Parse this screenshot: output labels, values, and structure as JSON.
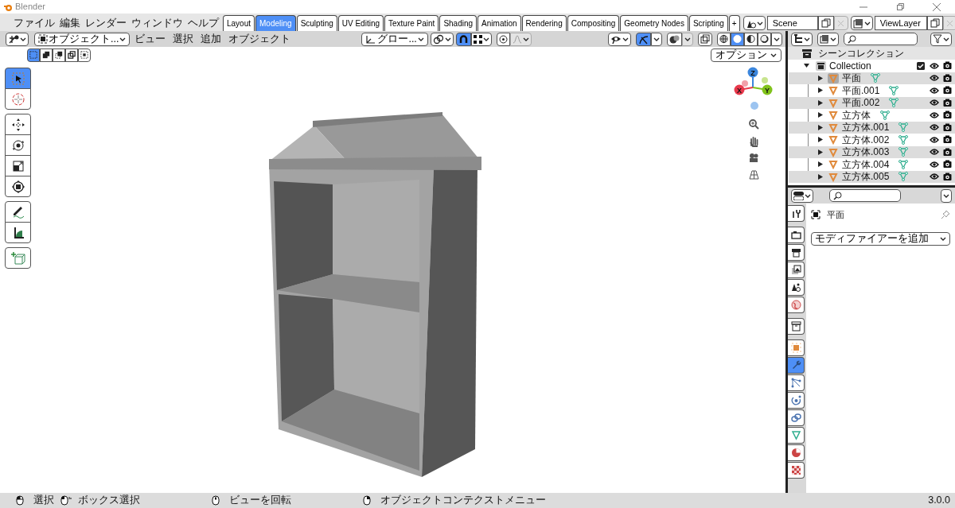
{
  "window": {
    "title": "Blender"
  },
  "menu": [
    "ファイル",
    "編集",
    "レンダー",
    "ウィンドウ",
    "ヘルプ"
  ],
  "workspaces": [
    {
      "label": "Layout",
      "selected": false
    },
    {
      "label": "Modeling",
      "selected": true
    },
    {
      "label": "Sculpting",
      "selected": false
    },
    {
      "label": "UV Editing",
      "selected": false
    },
    {
      "label": "Texture Paint",
      "selected": false
    },
    {
      "label": "Shading",
      "selected": false
    },
    {
      "label": "Animation",
      "selected": false
    },
    {
      "label": "Rendering",
      "selected": false
    },
    {
      "label": "Compositing",
      "selected": false
    },
    {
      "label": "Geometry Nodes",
      "selected": false
    },
    {
      "label": "Scripting",
      "selected": false
    }
  ],
  "add_workspace": "+",
  "scene": {
    "value": "Scene"
  },
  "view_layer": {
    "value": "ViewLayer"
  },
  "viewport": {
    "mode": "オブジェクト...",
    "menus": [
      "ビュー",
      "選択",
      "追加",
      "オブジェクト"
    ],
    "orientation": "グロー...",
    "snap": {
      "on": true
    },
    "proportional": {
      "on": false
    },
    "gizmos": {
      "on": true
    },
    "overlays": {
      "on": false
    },
    "xray": {
      "on": false
    },
    "shading": [
      {
        "kind": "wireframe",
        "selected": false
      },
      {
        "kind": "solid",
        "selected": true
      },
      {
        "kind": "material",
        "selected": false
      },
      {
        "kind": "rendered",
        "selected": false
      }
    ],
    "select_modes": [
      {
        "selected": true
      },
      {
        "selected": false
      },
      {
        "selected": false
      },
      {
        "selected": false
      },
      {
        "selected": false
      }
    ],
    "options": "オプション",
    "tool_groups": [
      {
        "tools": [
          {
            "kind": "select",
            "selected": true
          },
          {
            "kind": "cursor",
            "selected": false
          }
        ]
      },
      {
        "tools": [
          {
            "kind": "move",
            "selected": false
          },
          {
            "kind": "rotate",
            "selected": false
          },
          {
            "kind": "scale",
            "selected": false
          },
          {
            "kind": "transform",
            "selected": false
          }
        ]
      },
      {
        "tools": [
          {
            "kind": "annotate",
            "selected": false
          },
          {
            "kind": "measure",
            "selected": false
          }
        ]
      },
      {
        "tools": [
          {
            "kind": "add_cube",
            "selected": false
          }
        ]
      }
    ],
    "axes": [
      "Z",
      "X",
      "Y"
    ]
  },
  "outliner": {
    "root": "シーンコレクション",
    "collection": {
      "label": "Collection",
      "expanded": true,
      "checked": true,
      "children": [
        {
          "label": "平面",
          "selected": true
        },
        {
          "label": "平面.001",
          "selected": false
        },
        {
          "label": "平面.002",
          "selected": false
        },
        {
          "label": "立方体",
          "selected": false
        },
        {
          "label": "立方体.001",
          "selected": false
        },
        {
          "label": "立方体.002",
          "selected": false
        },
        {
          "label": "立方体.003",
          "selected": false
        },
        {
          "label": "立方体.004",
          "selected": false
        },
        {
          "label": "立方体.005",
          "selected": false
        }
      ]
    }
  },
  "properties": {
    "object": "平面",
    "add_modifier": "モディファイアーを追加",
    "tabs": [
      {
        "kind": "tool",
        "selected": false
      },
      {
        "kind": "render",
        "selected": false
      },
      {
        "kind": "output",
        "selected": false
      },
      {
        "kind": "view_layer",
        "selected": false
      },
      {
        "kind": "scene",
        "selected": false
      },
      {
        "kind": "world",
        "selected": false
      },
      {
        "kind": "collection",
        "selected": false
      },
      {
        "kind": "object",
        "selected": false
      },
      {
        "kind": "modifiers",
        "selected": true
      },
      {
        "kind": "particles",
        "selected": false
      },
      {
        "kind": "physics",
        "selected": false
      },
      {
        "kind": "constraints",
        "selected": false
      },
      {
        "kind": "data",
        "selected": false
      },
      {
        "kind": "material",
        "selected": false
      },
      {
        "kind": "texture",
        "selected": false
      }
    ]
  },
  "status_bar": {
    "hints": [
      "選択",
      "ボックス選択",
      "ビューを回転",
      "オブジェクトコンテクストメニュー"
    ],
    "version": "3.0.0"
  }
}
